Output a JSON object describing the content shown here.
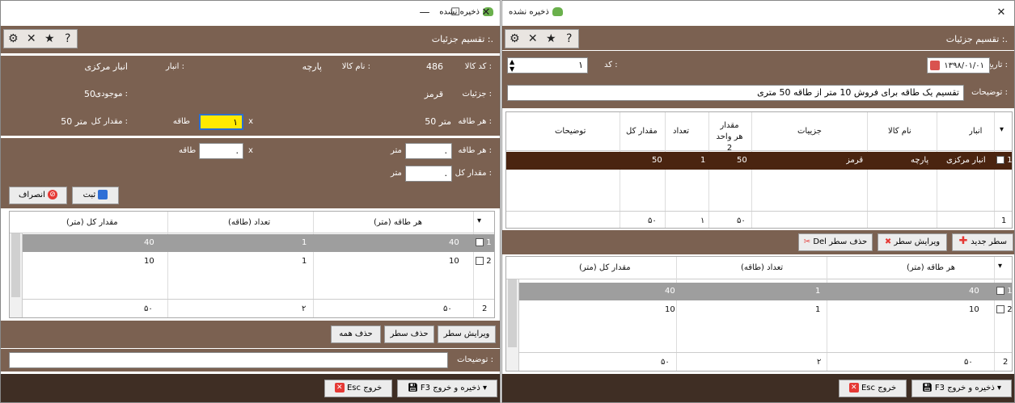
{
  "left": {
    "title": "ذخیره نشده",
    "controls": {
      "minimize": "—",
      "maximize": "☐",
      "close": "✕"
    },
    "header_caption": ".: تقسیم جزئیات",
    "info": {
      "code_label": "کد کالا :",
      "code_value": "486",
      "name_label": "نام کالا :",
      "name_value": "پارچه",
      "store_label": "انبار :",
      "store_value": "انبار مرکزی",
      "details_label": "جزئیات :",
      "details_value": "قرمز",
      "stock_label": "موجودی :",
      "stock_value": "50",
      "per_roll_label": "هر طاقه :",
      "per_roll_value": "50 متر",
      "times": "x",
      "multiplier_value": "۱",
      "roll_unit": "طاقه",
      "total_label": "مقدار کل :",
      "total_value": "50 متر"
    },
    "entry": {
      "per_roll_label": "هر طاقه :",
      "per_roll_input": ".",
      "meter_unit": "متر",
      "times": "x",
      "count_input": ".",
      "roll_unit": "طاقه",
      "total_label": "مقدار کل :",
      "total_input": ".",
      "total_unit": "متر",
      "save_label": "ثبت",
      "cancel_label": "انصراف"
    },
    "grid": {
      "columns": [
        "هر طاقه (متر)",
        "تعداد (طاقه)",
        "مقدار کل (متر)"
      ],
      "rows": [
        {
          "num": "1",
          "per_roll": "40",
          "count": "1",
          "total": "40"
        },
        {
          "num": "2",
          "per_roll": "10",
          "count": "1",
          "total": "10"
        }
      ],
      "footer": {
        "count": "2",
        "per_roll": "۵۰",
        "count_sum": "۲",
        "total": "۵۰"
      }
    },
    "actions": {
      "edit_row": "ویرایش سطر",
      "delete_row": "حذف سطر",
      "delete_all": "حذف همه"
    },
    "notes_label": "توضیحات :",
    "bottom": {
      "save_exit": "ذخیره و خروج F3",
      "exit": "خروج Esc"
    }
  },
  "right": {
    "title": "ذخیره نشده",
    "close": "✕",
    "header_caption": ".: تقسیم جزئیات",
    "form": {
      "date_label": "تاریخ :",
      "date_value": "۱۳۹۸/۰۱/۰۱",
      "code_label": "کد :",
      "code_value": "۱",
      "desc_label": "توضیحات :",
      "desc_value": "تقسیم یک طاقه برای فروش 10 متر از طاقه 50 متری"
    },
    "grid": {
      "columns": [
        "انبار",
        "نام کالا",
        "جزییات",
        "مقدار هر واحد 2",
        "تعداد",
        "مقدار کل",
        "توضیحات"
      ],
      "rows": [
        {
          "num": "1",
          "store": "انبار مرکزی",
          "name": "پارچه",
          "details": "قرمز",
          "unit": "50",
          "count": "1",
          "total": "50",
          "notes": ""
        }
      ],
      "footer": {
        "count": "1",
        "unit": "۵۰",
        "count_sum": "۱",
        "total": "۵۰"
      }
    },
    "actions": {
      "new_row": "سطر جدید",
      "edit_row": "ویرایش سطر",
      "delete_row": "حذف سطر Del"
    },
    "grid2": {
      "columns": [
        "هر طاقه (متر)",
        "تعداد (طاقه)",
        "مقدار کل (متر)"
      ],
      "rows": [
        {
          "num": "1",
          "per_roll": "40",
          "count": "1",
          "total": "40"
        },
        {
          "num": "2",
          "per_roll": "10",
          "count": "1",
          "total": "10"
        }
      ],
      "footer": {
        "count": "2",
        "per_roll": "۵۰",
        "count_sum": "۲",
        "total": "۵۰"
      }
    },
    "bottom": {
      "save_exit": "ذخیره و خروج F3",
      "exit": "خروج Esc"
    }
  },
  "colors": {
    "header_brown": "#7b6151",
    "dark_brown": "#3f2e24",
    "selected_row": "#9e9e9e",
    "highlight_row": "#4a2410",
    "edit_field": "#ffea00"
  }
}
